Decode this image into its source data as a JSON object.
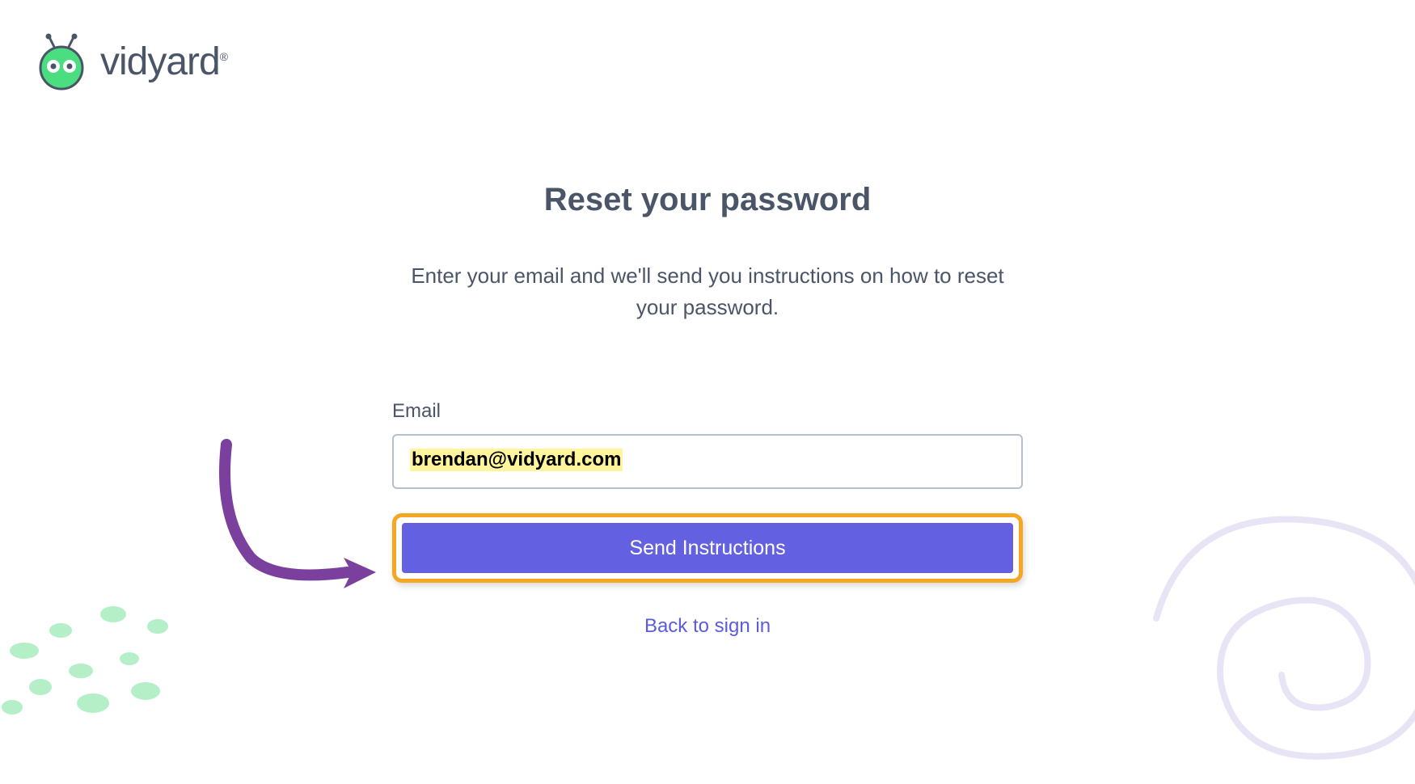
{
  "logo": {
    "text": "vidyard",
    "registered": "®"
  },
  "page": {
    "title": "Reset your password",
    "description": "Enter your email and we'll send you instructions on how to reset your password."
  },
  "form": {
    "email_label": "Email",
    "email_value": "brendan@vidyard.com",
    "submit_label": "Send Instructions",
    "back_link_label": "Back to sign in"
  }
}
